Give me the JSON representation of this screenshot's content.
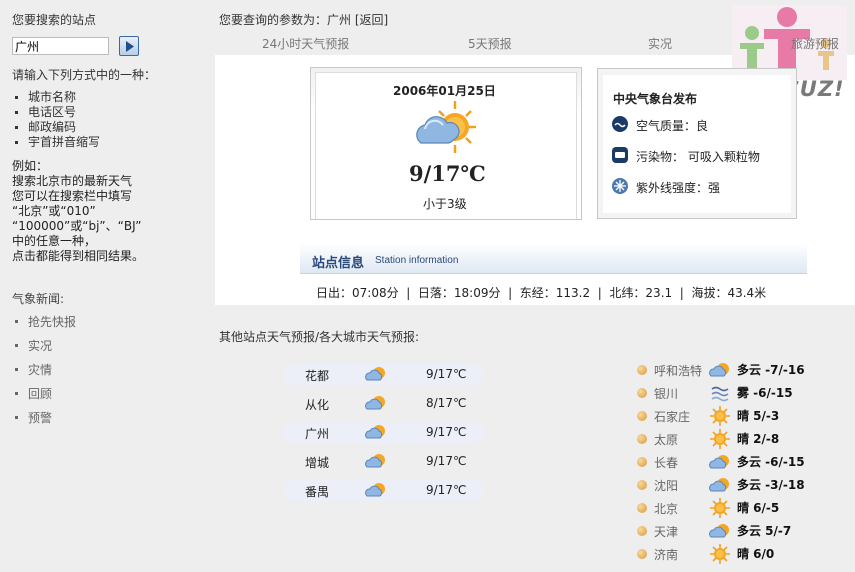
{
  "sidebar": {
    "title": "您要搜索的站点",
    "search_value": "广州",
    "hint": "请输入下列方式中的一种：",
    "options": [
      "城市名称",
      "电话区号",
      "邮政编码",
      "宇首拼音缩写"
    ],
    "example_lines": [
      "例如：",
      "搜索北京市的最新天气",
      "您可以在搜索栏中填写",
      "“北京”或“010”",
      "“100000”或“bj”、“BJ”",
      "中的任意一种，",
      "点击都能得到相同结果。"
    ],
    "news_title": "气象新闻:",
    "news_items": [
      "抢先快报",
      "实况",
      "灾情",
      "回顾",
      "预警"
    ]
  },
  "header": {
    "query_prefix": "您要查询的参数为：",
    "query_city": "广州",
    "back_link": "[返回]",
    "tabs": [
      "24小时天气预报",
      "5天预报",
      "实况",
      "旅游预报"
    ]
  },
  "logo": {
    "text": "DISCUZ!"
  },
  "forecast": {
    "date": "2006年01月25日",
    "icon": "cloudy-sun-icon",
    "temp": "9/17℃",
    "wind": "小于3级"
  },
  "publisher": {
    "title": "中央气象台发布",
    "rows": [
      {
        "icon": "air-quality-icon",
        "text": "空气质量：良"
      },
      {
        "icon": "pollutant-icon",
        "text": "污染物： 可吸入颗粒物"
      },
      {
        "icon": "uv-icon",
        "text": "紫外线强度：强"
      }
    ]
  },
  "station": {
    "title": "站点信息",
    "title_en": "Station information",
    "line": "日出：07:08分  |  日落：18:09分  |  东经：113.2  |  北纬：23.1  |  海拔：43.4米"
  },
  "other": {
    "title": "其他站点天气预报/各大城市天气预报:",
    "stations": [
      {
        "name": "花都",
        "temp": "9/17℃"
      },
      {
        "name": "从化",
        "temp": "8/17℃"
      },
      {
        "name": "广州",
        "temp": "9/17℃"
      },
      {
        "name": "增城",
        "temp": "9/17℃"
      },
      {
        "name": "番禺",
        "temp": "9/17℃"
      }
    ]
  },
  "cities": [
    {
      "name": "呼和浩特",
      "desc": "多云 -7/-16",
      "icon": "cloudy-sun-icon"
    },
    {
      "name": "银川",
      "desc": "雾 -6/-15",
      "icon": "fog-icon"
    },
    {
      "name": "石家庄",
      "desc": "晴 5/-3",
      "icon": "sun-icon"
    },
    {
      "name": "太原",
      "desc": "晴 2/-8",
      "icon": "sun-icon"
    },
    {
      "name": "长春",
      "desc": "多云 -6/-15",
      "icon": "cloudy-sun-icon"
    },
    {
      "name": "沈阳",
      "desc": "多云 -3/-18",
      "icon": "cloudy-sun-icon"
    },
    {
      "name": "北京",
      "desc": "晴 6/-5",
      "icon": "sun-icon"
    },
    {
      "name": "天津",
      "desc": "多云 5/-7",
      "icon": "cloudy-sun-icon"
    },
    {
      "name": "济南",
      "desc": "晴 6/0",
      "icon": "sun-icon"
    }
  ]
}
